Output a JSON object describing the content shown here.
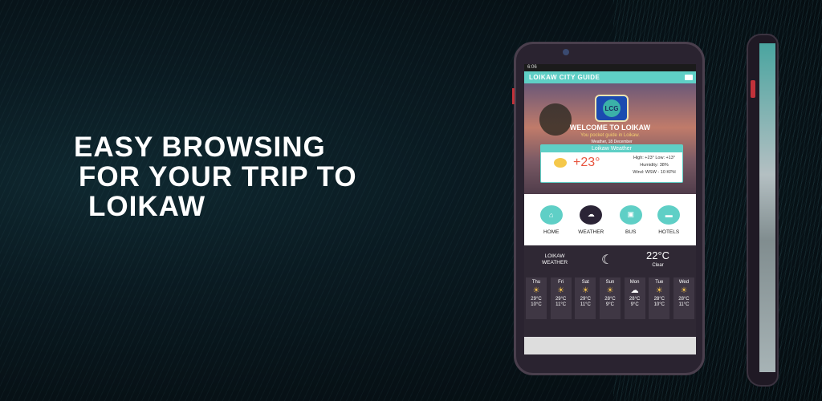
{
  "headline": {
    "line1": "EASY BROWSING",
    "line2": "FOR YOUR TRIP TO",
    "line3": "LOIKAW"
  },
  "phone": {
    "status_time": "6:06",
    "app_title": "LOIKAW CITY GUIDE",
    "logo_text": "LCG",
    "welcome": "WELCOME TO LOIKAW",
    "subtitle": "You pocket guide in Loikaw.",
    "weather_card": {
      "date": "Weather, 18 December",
      "title": "Loikaw Weather",
      "temp": "+23°",
      "high_low": "High: +23° Low: +13°",
      "humidity": "Humidity: 38%",
      "wind": "Wind: WSW - 10 KPH"
    },
    "nav": [
      {
        "label": "HOME",
        "icon": "home-icon"
      },
      {
        "label": "WEATHER",
        "icon": "cloud-icon"
      },
      {
        "label": "BUS",
        "icon": "bus-icon"
      },
      {
        "label": "HOTELS",
        "icon": "bed-icon"
      }
    ],
    "forecast": {
      "location": "LOIKAW",
      "location_sub": "WEATHER",
      "current_temp": "22°C",
      "current_cond": "Clear",
      "days": [
        {
          "day": "Thu",
          "high": "29°C",
          "low": "10°C"
        },
        {
          "day": "Fri",
          "high": "29°C",
          "low": "11°C"
        },
        {
          "day": "Sat",
          "high": "29°C",
          "low": "11°C"
        },
        {
          "day": "Sun",
          "high": "28°C",
          "low": "9°C"
        },
        {
          "day": "Mon",
          "high": "28°C",
          "low": "9°C"
        },
        {
          "day": "Tue",
          "high": "28°C",
          "low": "10°C"
        },
        {
          "day": "Wed",
          "high": "28°C",
          "low": "11°C"
        }
      ]
    }
  },
  "colors": {
    "accent": "#5fcfc6",
    "dark_panel": "#2f2834",
    "temp": "#e8553f"
  }
}
